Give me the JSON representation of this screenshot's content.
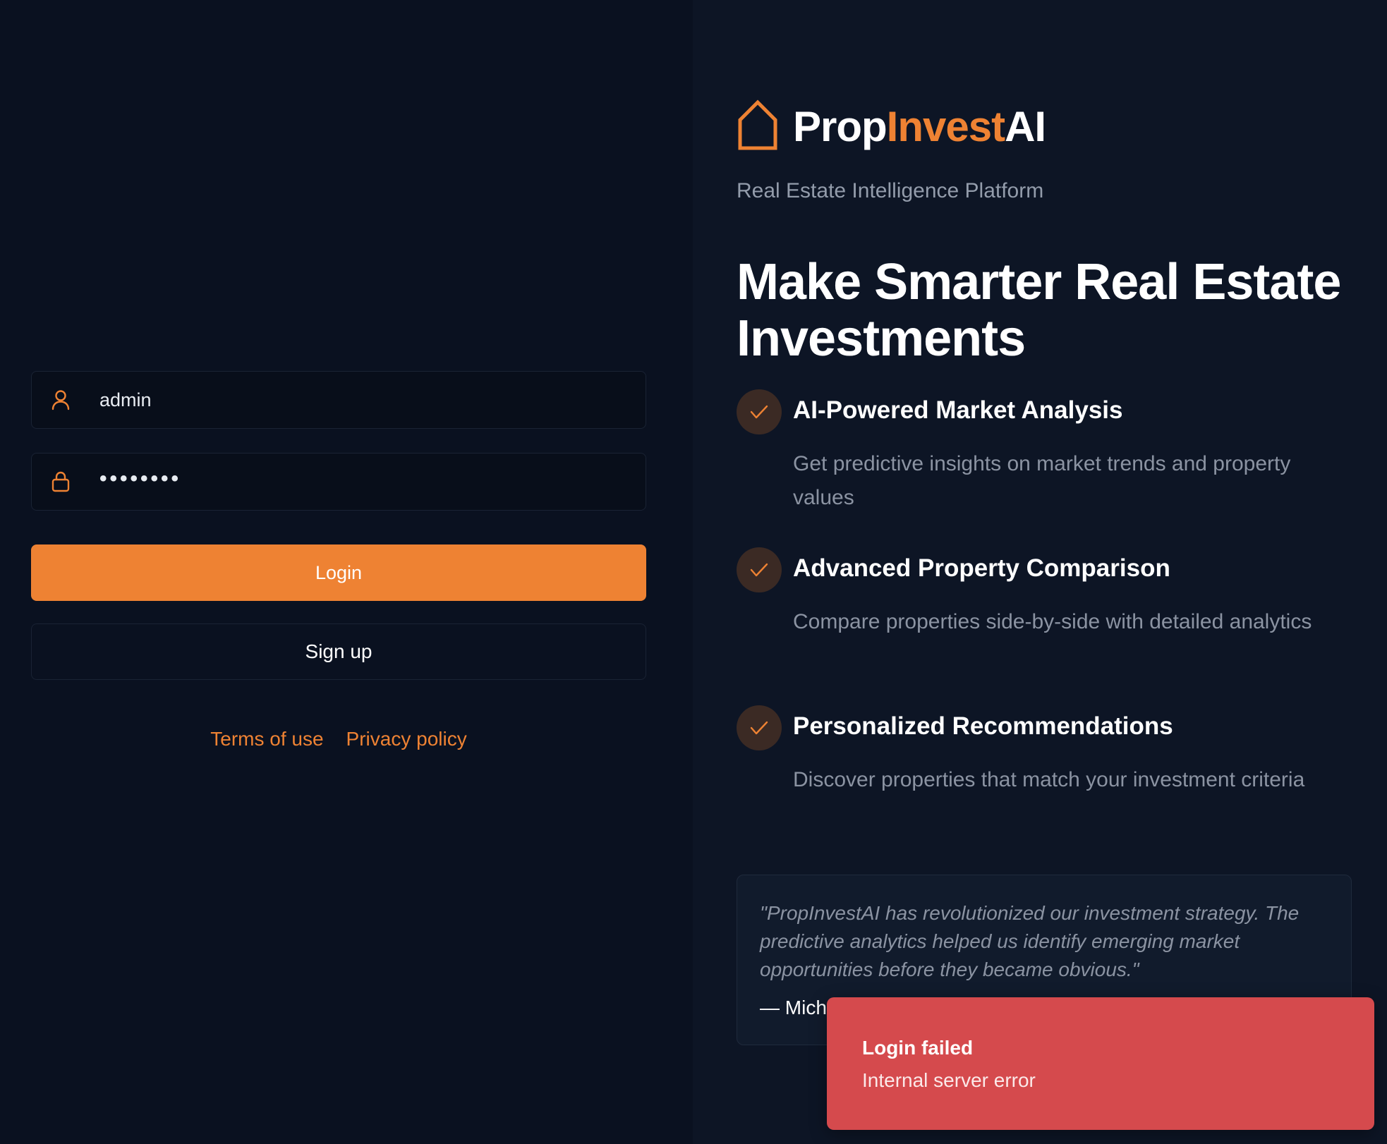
{
  "login_form": {
    "username_value": "admin",
    "password_value": "••••••••",
    "login_label": "Login",
    "signup_label": "Sign up",
    "terms_label": "Terms of use",
    "privacy_label": "Privacy policy"
  },
  "brand": {
    "name_prefix": "Prop",
    "name_accent": "Invest",
    "name_suffix": "AI",
    "tagline": "Real Estate Intelligence Platform",
    "logo_icon": "house-icon"
  },
  "headline": "Make Smarter Real Estate Investments",
  "features": [
    {
      "title": "AI-Powered Market Analysis",
      "description": "Get predictive insights on market trends and property values"
    },
    {
      "title": "Advanced Property Comparison",
      "description": "Compare properties side-by-side with detailed analytics"
    },
    {
      "title": "Personalized Recommendations",
      "description": "Discover properties that match your investment criteria"
    }
  ],
  "testimonial": {
    "quote": "\"PropInvestAI has revolutionized our investment strategy. The predictive analytics helped us identify emerging market opportunities before they became obvious.\"",
    "author": "— Mich"
  },
  "toast": {
    "title": "Login failed",
    "message": "Internal server error"
  },
  "colors": {
    "accent": "#ee8233",
    "background_left": "#0a1120",
    "background_right": "#0d1525",
    "toast_error": "#d54a4d"
  },
  "icons": {
    "username": "user-icon",
    "password": "lock-icon",
    "feature_check": "check-icon"
  }
}
